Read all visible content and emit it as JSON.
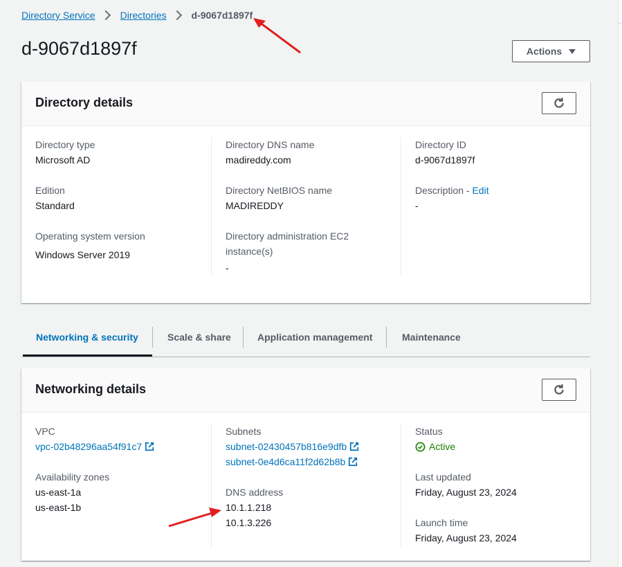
{
  "breadcrumb": {
    "items": [
      "Directory Service",
      "Directories"
    ],
    "current": "d-9067d1897f"
  },
  "page": {
    "title": "d-9067d1897f",
    "actions_label": "Actions"
  },
  "directory_details": {
    "title": "Directory details",
    "col1": [
      {
        "label": "Directory type",
        "value": "Microsoft AD"
      },
      {
        "label": "Edition",
        "value": "Standard"
      },
      {
        "label": "Operating system version",
        "value": "Windows Server 2019"
      }
    ],
    "col2": [
      {
        "label": "Directory DNS name",
        "value": "madireddy.com"
      },
      {
        "label": "Directory NetBIOS name",
        "value": "MADIREDDY"
      },
      {
        "label": "Directory administration EC2 instance(s)",
        "value": "-"
      }
    ],
    "col3": [
      {
        "label": "Directory ID",
        "value": "d-9067d1897f"
      },
      {
        "label": "Description - ",
        "edit": "Edit",
        "value": "-"
      }
    ]
  },
  "tabs": [
    "Networking & security",
    "Scale & share",
    "Application management",
    "Maintenance"
  ],
  "networking_details": {
    "title": "Networking details",
    "vpc": {
      "label": "VPC",
      "value": "vpc-02b48296aa54f91c7"
    },
    "availability_zones": {
      "label": "Availability zones",
      "values": [
        "us-east-1a",
        "us-east-1b"
      ]
    },
    "subnets": {
      "label": "Subnets",
      "values": [
        "subnet-02430457b816e9dfb",
        "subnet-0e4d6ca11f2d62b8b"
      ]
    },
    "dns_address": {
      "label": "DNS address",
      "values": [
        "10.1.1.218",
        "10.1.3.226"
      ]
    },
    "status": {
      "label": "Status",
      "value": "Active"
    },
    "last_updated": {
      "label": "Last updated",
      "value": "Friday, August 23, 2024"
    },
    "launch_time": {
      "label": "Launch time",
      "value": "Friday, August 23, 2024"
    }
  },
  "icons": {
    "refresh": "refresh-icon",
    "external_link": "external-link-icon",
    "status_ok": "check-circle-icon",
    "actions_caret": "caret-down-icon"
  },
  "colors": {
    "link": "#0073bb",
    "status_success": "#1d8102",
    "annotation_arrow": "#e0201f"
  }
}
